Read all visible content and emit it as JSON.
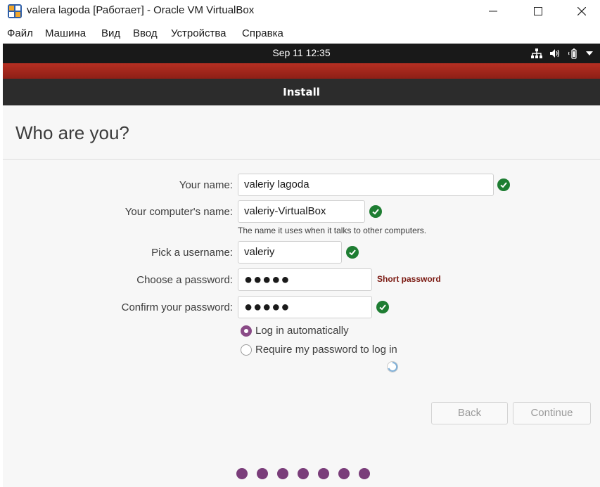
{
  "window": {
    "title": "valera lagoda [Работает] - Oracle VM VirtualBox",
    "app_icon": "virtualbox-icon",
    "controls": [
      "minimize-icon",
      "maximize-icon",
      "close-icon"
    ]
  },
  "menu": {
    "items": [
      "Файл",
      "Машина",
      "Вид",
      "Ввод",
      "Устройства",
      "Справка"
    ]
  },
  "guest": {
    "topbar": {
      "clock": "Sep 11  12:35",
      "status_icons": [
        "network-icon",
        "volume-icon",
        "battery-icon",
        "dropdown-arrow-icon"
      ]
    },
    "installer": {
      "header_title": "Install",
      "page_title": "Who are you?",
      "fields": {
        "name_label": "Your name:",
        "name_value": "valeriy lagoda",
        "computer_label": "Your computer's name:",
        "computer_value": "valeriy-VirtualBox",
        "computer_hint": "The name it uses when it talks to other computers.",
        "username_label": "Pick a username:",
        "username_value": "valeriy",
        "password_label": "Choose a password:",
        "password_value": "●●●●●",
        "password_strength": "Short password",
        "confirm_label": "Confirm your password:",
        "confirm_value": "●●●●●"
      },
      "login": {
        "auto_label": "Log in automatically",
        "require_label": "Require my password to log in",
        "selected": "auto"
      },
      "buttons": {
        "back": "Back",
        "continue": "Continue"
      },
      "progress_steps": 7
    }
  },
  "colors": {
    "accent": "#7a3d7a",
    "valid_check": "#1e7d32",
    "warning_text": "#7b1a12",
    "banner_red": "#b62f22",
    "header_dark": "#2c2c2c"
  }
}
